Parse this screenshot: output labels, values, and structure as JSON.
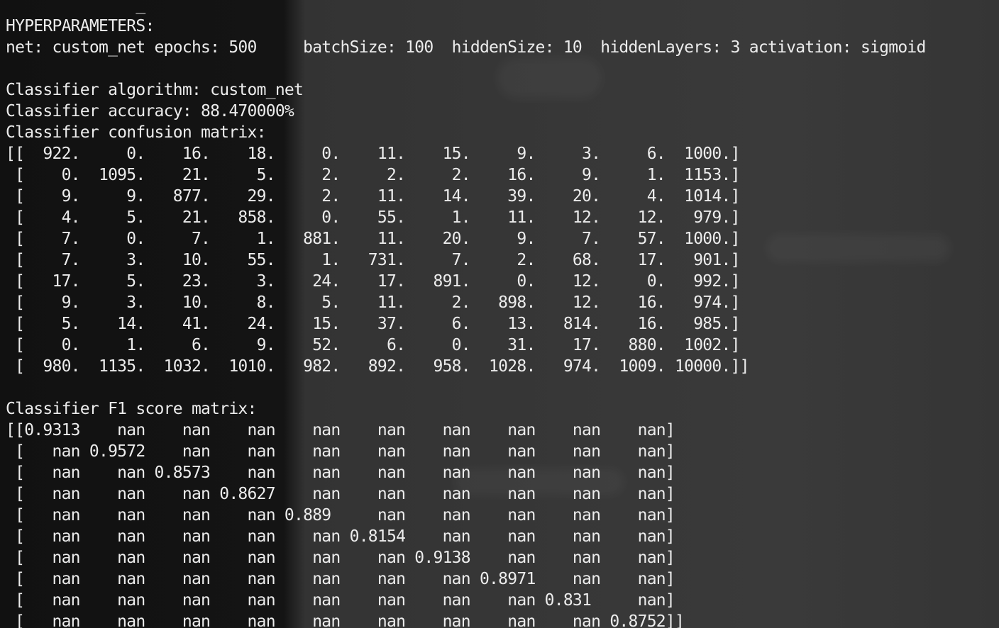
{
  "terminal": {
    "partial_line": "              _",
    "hyper_header": "HYPERPARAMETERS:",
    "hyper_values": "net: custom_net epochs: 500     batchSize: 100  hiddenSize: 10  hiddenLayers: 3 activation: sigmoid",
    "algorithm_line": "Classifier algorithm: custom_net",
    "accuracy_line": "Classifier accuracy: 88.470000%",
    "confusion_header": "Classifier confusion matrix:",
    "confusion_rows": [
      "[[  922.     0.    16.    18.     0.    11.    15.     9.     3.     6.  1000.]",
      " [    0.  1095.    21.     5.     2.     2.     2.    16.     9.     1.  1153.]",
      " [    9.     9.   877.    29.     2.    11.    14.    39.    20.     4.  1014.]",
      " [    4.     5.    21.   858.     0.    55.     1.    11.    12.    12.   979.]",
      " [    7.     0.     7.     1.   881.    11.    20.     9.     7.    57.  1000.]",
      " [    7.     3.    10.    55.     1.   731.     7.     2.    68.    17.   901.]",
      " [   17.     5.    23.     3.    24.    17.   891.     0.    12.     0.   992.]",
      " [    9.     3.    10.     8.     5.    11.     2.   898.    12.    16.   974.]",
      " [    5.    14.    41.    24.    15.    37.     6.    13.   814.    16.   985.]",
      " [    0.     1.     6.     9.    52.     6.     0.    31.    17.   880.  1002.]",
      " [  980.  1135.  1032.  1010.   982.   892.   958.  1028.   974.  1009. 10000.]]"
    ],
    "f1_header": "Classifier F1 score matrix:",
    "f1_rows": [
      "[[0.9313    nan    nan    nan    nan    nan    nan    nan    nan    nan]",
      " [   nan 0.9572    nan    nan    nan    nan    nan    nan    nan    nan]",
      " [   nan    nan 0.8573    nan    nan    nan    nan    nan    nan    nan]",
      " [   nan    nan    nan 0.8627    nan    nan    nan    nan    nan    nan]",
      " [   nan    nan    nan    nan 0.889     nan    nan    nan    nan    nan]",
      " [   nan    nan    nan    nan    nan 0.8154    nan    nan    nan    nan]",
      " [   nan    nan    nan    nan    nan    nan 0.9138    nan    nan    nan]",
      " [   nan    nan    nan    nan    nan    nan    nan 0.8971    nan    nan]",
      " [   nan    nan    nan    nan    nan    nan    nan    nan 0.831     nan]",
      " [   nan    nan    nan    nan    nan    nan    nan    nan    nan 0.8752]]"
    ]
  }
}
